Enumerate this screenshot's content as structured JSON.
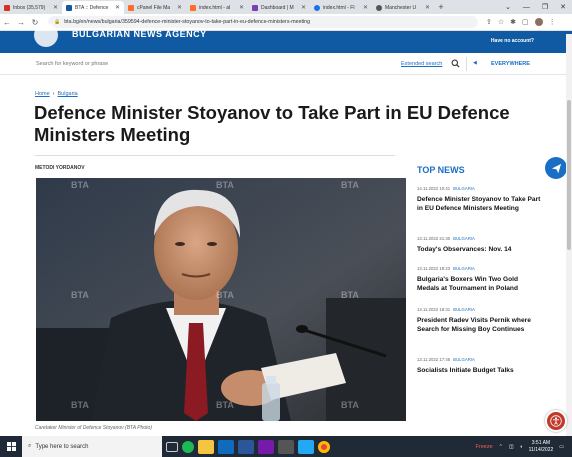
{
  "browser": {
    "tabs": [
      {
        "label": "Inbox (35,579)",
        "color": "#d93025",
        "active": false
      },
      {
        "label": "BTA :: Defence",
        "color": "#0f5aa3",
        "active": true
      },
      {
        "label": "cPanel File Ma",
        "color": "#ff6c2c",
        "active": false
      },
      {
        "label": "index.html - aI",
        "color": "#ff6c2c",
        "active": false
      },
      {
        "label": "Dashboard | M",
        "color": "#7b3fb4",
        "active": false
      },
      {
        "label": "index.html - FI",
        "color": "#1a73e8",
        "active": false
      },
      {
        "label": "Manchester U",
        "color": "#555555",
        "active": false
      }
    ],
    "url": "bta.bg/en/news/bulgaria/359594-defence-minister-stoyanov-to-take-part-in-eu-defence-ministers-meeting"
  },
  "site": {
    "logo_text": "BULGARIAN NEWS AGENCY",
    "account_link": "Have no account?",
    "search_placeholder": "Search for keyword or phrase",
    "extended_search": "Extended search",
    "region": "EVERYWHERE"
  },
  "article": {
    "breadcrumb": {
      "home": "Home",
      "separator": "›",
      "section": "Bulgaria"
    },
    "headline": "Defence Minister Stoyanov to Take Part in EU Defence Ministers Meeting",
    "author": "METODI YORDANOV",
    "caption": "Caretaker Minister of Defence Stoyanov (BTA Photo)",
    "watermark": "BTA"
  },
  "top_news": {
    "title": "TOP NEWS",
    "items": [
      {
        "time": "14.11.2022 10:41",
        "category": "BULGARIA",
        "title": "Defence Minister Stoyanov to Take Part in EU Defence Ministers Meeting"
      },
      {
        "time": "13.11.2022 21:30",
        "category": "BULGARIA",
        "title": "Today's Observances: Nov. 14"
      },
      {
        "time": "13.11.2022 19:23",
        "category": "BULGARIA",
        "title": "Bulgaria's Boxers Win Two Gold Medals at Tournament in Poland"
      },
      {
        "time": "13.11.2022 18:31",
        "category": "BULGARIA",
        "title": "President Radev Visits Pernik where Search for Missing Boy Continues"
      },
      {
        "time": "13.11.2022 17:45",
        "category": "BULGARIA",
        "title": "Socialists Initiate Budget Talks"
      }
    ]
  },
  "taskbar": {
    "search_placeholder": "Type here to search",
    "weather": "Freeze",
    "time": "3:51 AM",
    "date": "11/14/2022"
  },
  "colors": {
    "brand": "#0f5aa3",
    "link": "#1a6fc4"
  }
}
